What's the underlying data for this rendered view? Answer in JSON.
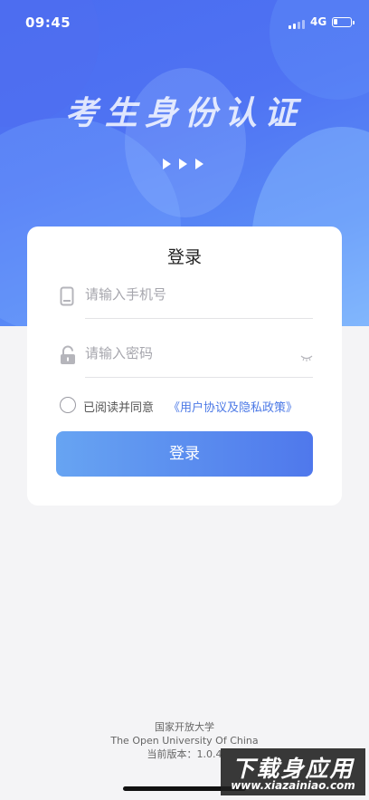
{
  "status": {
    "time": "09:45",
    "network": "4G"
  },
  "hero": {
    "title": "考生身份认证"
  },
  "card": {
    "title": "登录",
    "phone_placeholder": "请输入手机号",
    "password_placeholder": "请输入密码",
    "agree_text": "已阅读并同意",
    "agree_link": "《用户协议及隐私政策》",
    "login_label": "登录"
  },
  "footer": {
    "org": "国家开放大学",
    "org_en": "The Open University Of China",
    "version": "当前版本：1.0.4"
  },
  "watermark": {
    "cn": "下载身应用",
    "url": "www.xiazainiao.com"
  },
  "colors": {
    "accent": "#4f73f3",
    "link": "#4c79e6",
    "button_start": "#67a4f2",
    "button_end": "#4f78ec"
  },
  "icons": [
    "phone-icon",
    "lock-icon",
    "eye-closed-icon",
    "signal-icon",
    "battery-icon"
  ]
}
